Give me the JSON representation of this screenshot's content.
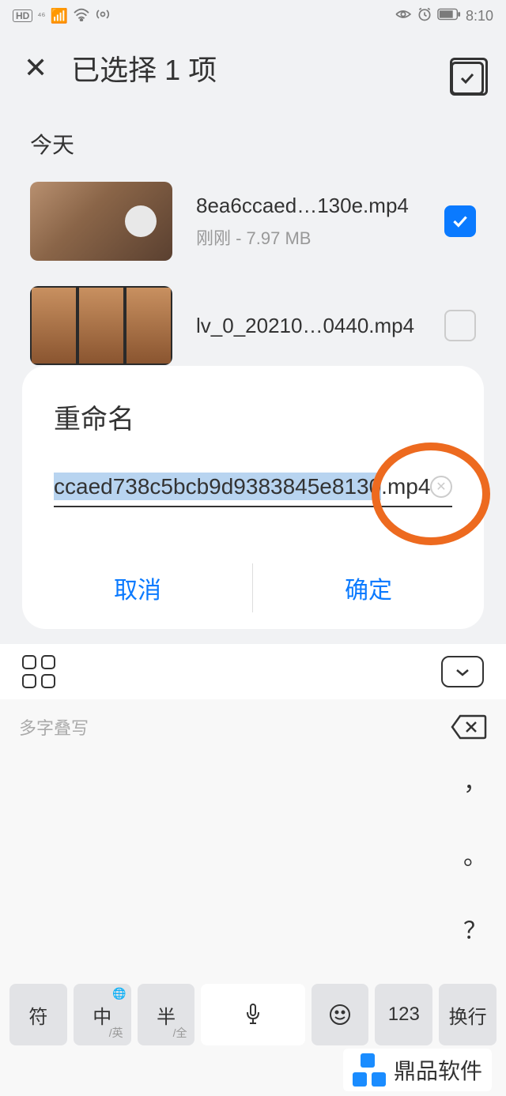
{
  "statusbar": {
    "time": "8:10"
  },
  "header": {
    "title": "已选择 1 项"
  },
  "section": {
    "today": "今天"
  },
  "files": [
    {
      "name": "8ea6ccaed…130e.mp4",
      "meta": "刚刚 - 7.97 MB",
      "checked": true
    },
    {
      "name": "lv_0_20210…0440.mp4",
      "meta": "",
      "checked": false
    }
  ],
  "dialog": {
    "title": "重命名",
    "input_selected": "ccaed738c5bcb9d9383845e8130",
    "input_ext": ".mp4",
    "cancel": "取消",
    "confirm": "确定"
  },
  "keyboard": {
    "hint": "多字叠写",
    "symbols": [
      "，",
      "。",
      "？",
      "！"
    ],
    "keys": {
      "sym": "符",
      "zh": "中",
      "zh_sub": "/英",
      "half": "半",
      "half_sub": "/全",
      "emoji": "☺",
      "num": "123",
      "enter": "换行"
    }
  },
  "watermark": {
    "text": "鼎品软件"
  }
}
